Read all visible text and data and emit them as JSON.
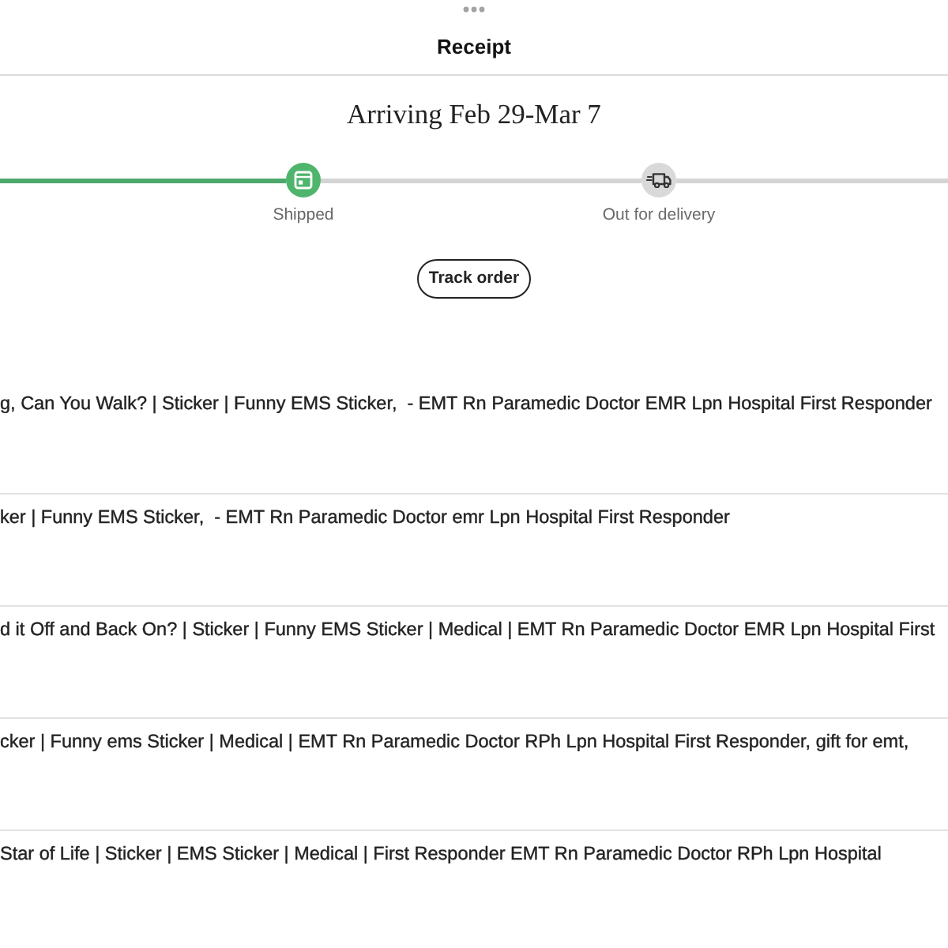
{
  "header": {
    "title": "Receipt"
  },
  "delivery": {
    "heading": "Arriving Feb 29-Mar 7",
    "steps": [
      {
        "label": "Shipped",
        "kind": "box",
        "done": true
      },
      {
        "label": "Out for delivery",
        "kind": "truck",
        "done": false
      }
    ],
    "button": "Track order"
  },
  "items": [
    {
      "title": "g, Can You Walk? | Sticker | Funny EMS Sticker,  - EMT Rn Paramedic Doctor EMR Lpn Hospital First Responder"
    },
    {
      "title": "ker | Funny EMS Sticker,  - EMT Rn Paramedic Doctor emr Lpn Hospital First Responder"
    },
    {
      "title": "d it Off and Back On? | Sticker | Funny EMS Sticker | Medical | EMT Rn Paramedic Doctor EMR Lpn Hospital First"
    },
    {
      "title": "cker | Funny ems Sticker | Medical | EMT Rn Paramedic Doctor RPh Lpn Hospital First Responder, gift for emt,"
    },
    {
      "title": "Star of Life | Sticker | EMS Sticker | Medical | First Responder EMT Rn Paramedic Doctor RPh Lpn Hospital"
    }
  ]
}
